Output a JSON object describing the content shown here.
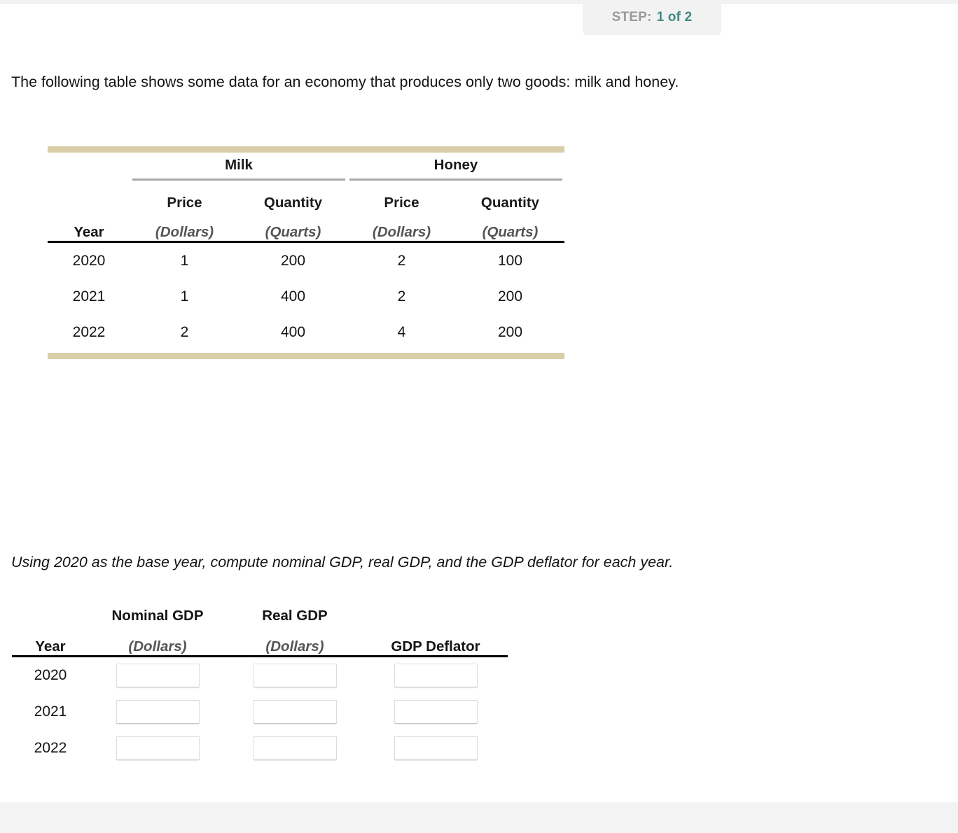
{
  "step_badge": {
    "label": "STEP:",
    "value": "1 of 2",
    "label_color": "#9a9a9a",
    "value_color": "#3d8b84"
  },
  "intro_text": "The following table shows some data for an economy that produces only two goods: milk and honey.",
  "prompt_text": "Using 2020 as the base year, compute nominal GDP, real GDP, and the GDP deflator for each year.",
  "data_table": {
    "accent_color": "#d8cfa8",
    "groups": [
      {
        "label": "Milk"
      },
      {
        "label": "Honey"
      }
    ],
    "year_header": "Year",
    "sub_headers": [
      "Price",
      "Quantity",
      "Price",
      "Quantity"
    ],
    "unit_headers": [
      "(Dollars)",
      "(Quarts)",
      "(Dollars)",
      "(Quarts)"
    ],
    "rows": [
      {
        "year": "2020",
        "milk_price": "1",
        "milk_quantity": "200",
        "honey_price": "2",
        "honey_quantity": "100"
      },
      {
        "year": "2021",
        "milk_price": "1",
        "milk_quantity": "400",
        "honey_price": "2",
        "honey_quantity": "200"
      },
      {
        "year": "2022",
        "milk_price": "2",
        "milk_quantity": "400",
        "honey_price": "4",
        "honey_quantity": "200"
      }
    ]
  },
  "answer_table": {
    "year_header": "Year",
    "title_headers": [
      "Nominal GDP",
      "Real GDP",
      ""
    ],
    "unit_headers": [
      "(Dollars)",
      "(Dollars)",
      "GDP Deflator"
    ],
    "rows": [
      {
        "year": "2020",
        "nominal_gdp": "",
        "real_gdp": "",
        "gdp_deflator": ""
      },
      {
        "year": "2021",
        "nominal_gdp": "",
        "real_gdp": "",
        "gdp_deflator": ""
      },
      {
        "year": "2022",
        "nominal_gdp": "",
        "real_gdp": "",
        "gdp_deflator": ""
      }
    ]
  }
}
